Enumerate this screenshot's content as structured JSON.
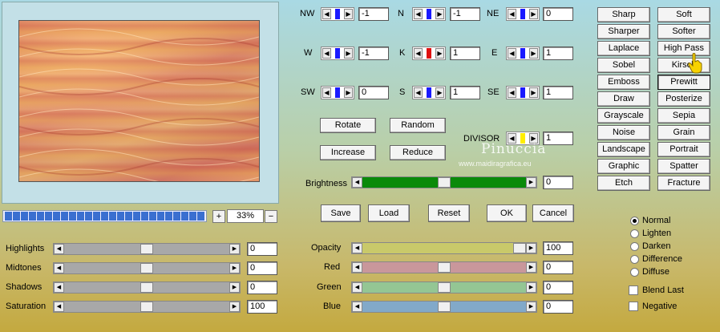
{
  "preview": {
    "zoom": "33%",
    "plus": "+",
    "minus": "−",
    "progress_segments": 25
  },
  "matrix": {
    "NW": {
      "label": "NW",
      "value": "-1"
    },
    "N": {
      "label": "N",
      "value": "-1"
    },
    "NE": {
      "label": "NE",
      "value": "0"
    },
    "W": {
      "label": "W",
      "value": "-1"
    },
    "K": {
      "label": "K",
      "value": "1"
    },
    "E": {
      "label": "E",
      "value": "1"
    },
    "SW": {
      "label": "SW",
      "value": "0"
    },
    "S": {
      "label": "S",
      "value": "1"
    },
    "SE": {
      "label": "SE",
      "value": "1"
    }
  },
  "divisor": {
    "label": "DIVISOR",
    "value": "1"
  },
  "actions": {
    "rotate": "Rotate",
    "random": "Random",
    "increase": "Increase",
    "reduce": "Reduce"
  },
  "brightness": {
    "label": "Brightness",
    "value": "0",
    "level": 0.5,
    "color": "#0a8a0a"
  },
  "dialog": {
    "save": "Save",
    "load": "Load",
    "reset": "Reset",
    "ok": "OK",
    "cancel": "Cancel"
  },
  "tones": [
    {
      "label": "Highlights",
      "value": "0",
      "level": 0.5
    },
    {
      "label": "Midtones",
      "value": "0",
      "level": 0.5
    },
    {
      "label": "Shadows",
      "value": "0",
      "level": 0.5
    },
    {
      "label": "Saturation",
      "value": "100",
      "level": 0.5
    }
  ],
  "channels": [
    {
      "label": "Opacity",
      "value": "100",
      "level": 1.0,
      "color": "#c9c96a"
    },
    {
      "label": "Red",
      "value": "0",
      "level": 0.5,
      "color": "#c9979b"
    },
    {
      "label": "Green",
      "value": "0",
      "level": 0.5,
      "color": "#94c694"
    },
    {
      "label": "Blue",
      "value": "0",
      "level": 0.5,
      "color": "#82a9c9"
    }
  ],
  "presets": [
    [
      "Sharp",
      "Soft"
    ],
    [
      "Sharper",
      "Softer"
    ],
    [
      "Laplace",
      "High Pass"
    ],
    [
      "Sobel",
      "Kirsch"
    ],
    [
      "Emboss",
      "Prewitt"
    ],
    [
      "Draw",
      "Posterize"
    ],
    [
      "Grayscale",
      "Sepia"
    ],
    [
      "Noise",
      "Grain"
    ],
    [
      "Landscape",
      "Portrait"
    ],
    [
      "Graphic",
      "Spatter"
    ],
    [
      "Etch",
      "Fracture"
    ]
  ],
  "pressed_preset": "Prewitt",
  "blend_modes": {
    "options": [
      "Normal",
      "Lighten",
      "Darken",
      "Difference",
      "Diffuse"
    ],
    "selected": "Normal"
  },
  "options": {
    "blend_last": "Blend Last",
    "negative": "Negative"
  },
  "watermark": {
    "name": "Pinuccia",
    "site": "www.maidiragrafica.eu"
  },
  "colors": {
    "thumb_blue": "#1a1aff",
    "thumb_red": "#e01010",
    "thumb_yellow": "#ffee00"
  }
}
